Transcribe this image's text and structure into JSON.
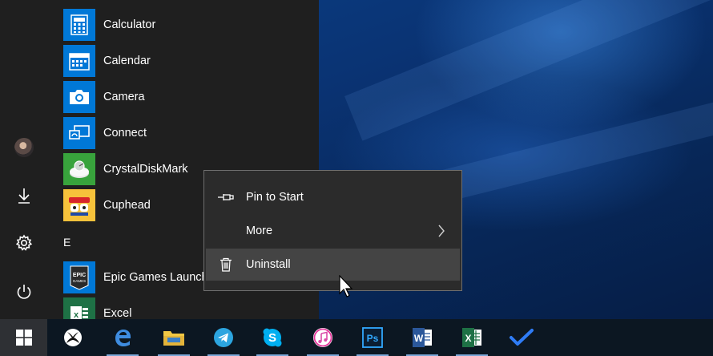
{
  "start_menu": {
    "apps": [
      {
        "label": "Calculator",
        "icon": "calculator-icon",
        "color": "#0078d7"
      },
      {
        "label": "Calendar",
        "icon": "calendar-icon",
        "color": "#0078d7"
      },
      {
        "label": "Camera",
        "icon": "camera-icon",
        "color": "#0078d7"
      },
      {
        "label": "Connect",
        "icon": "connect-icon",
        "color": "#0078d7"
      },
      {
        "label": "CrystalDiskMark",
        "icon": "crystaldiskmark-icon",
        "color": "#38a33c"
      },
      {
        "label": "Cuphead",
        "icon": "cuphead-icon",
        "color": "#f6c23b"
      },
      {
        "label": "Epic Games Launcher",
        "icon": "epic-games-icon",
        "color": "#0078d7"
      },
      {
        "label": "Excel",
        "icon": "excel-icon",
        "color": "#1e7145"
      }
    ],
    "section_letter": "E",
    "rail": [
      {
        "name": "user-avatar",
        "icon": "avatar"
      },
      {
        "name": "downloads",
        "icon": "download-icon"
      },
      {
        "name": "settings",
        "icon": "gear-icon"
      },
      {
        "name": "power",
        "icon": "power-icon"
      }
    ]
  },
  "context_menu": {
    "items": [
      {
        "label": "Pin to Start",
        "icon": "pin-icon"
      },
      {
        "label": "More",
        "icon": "",
        "submenu": true
      },
      {
        "label": "Uninstall",
        "icon": "trash-icon",
        "highlighted": true
      }
    ]
  },
  "taskbar": {
    "start_icon": "windows-logo-icon",
    "apps": [
      {
        "name": "xbox",
        "icon": "xbox-icon"
      },
      {
        "name": "edge",
        "icon": "edge-icon",
        "running": true
      },
      {
        "name": "file-explorer",
        "icon": "folder-icon",
        "running": true
      },
      {
        "name": "telegram",
        "icon": "telegram-icon",
        "running": true
      },
      {
        "name": "skype",
        "icon": "skype-icon",
        "running": true
      },
      {
        "name": "itunes",
        "icon": "itunes-icon",
        "running": true
      },
      {
        "name": "photoshop",
        "icon": "photoshop-icon",
        "running": true
      },
      {
        "name": "word",
        "icon": "word-icon",
        "running": true
      },
      {
        "name": "excel",
        "icon": "excel-icon",
        "running": true
      },
      {
        "name": "todo",
        "icon": "todo-check-icon"
      }
    ]
  },
  "colors": {
    "accent": "#0078d7",
    "start_bg": "#1f1f1f",
    "context_bg": "#2b2b2b",
    "taskbar_bg": "#0c1722"
  }
}
